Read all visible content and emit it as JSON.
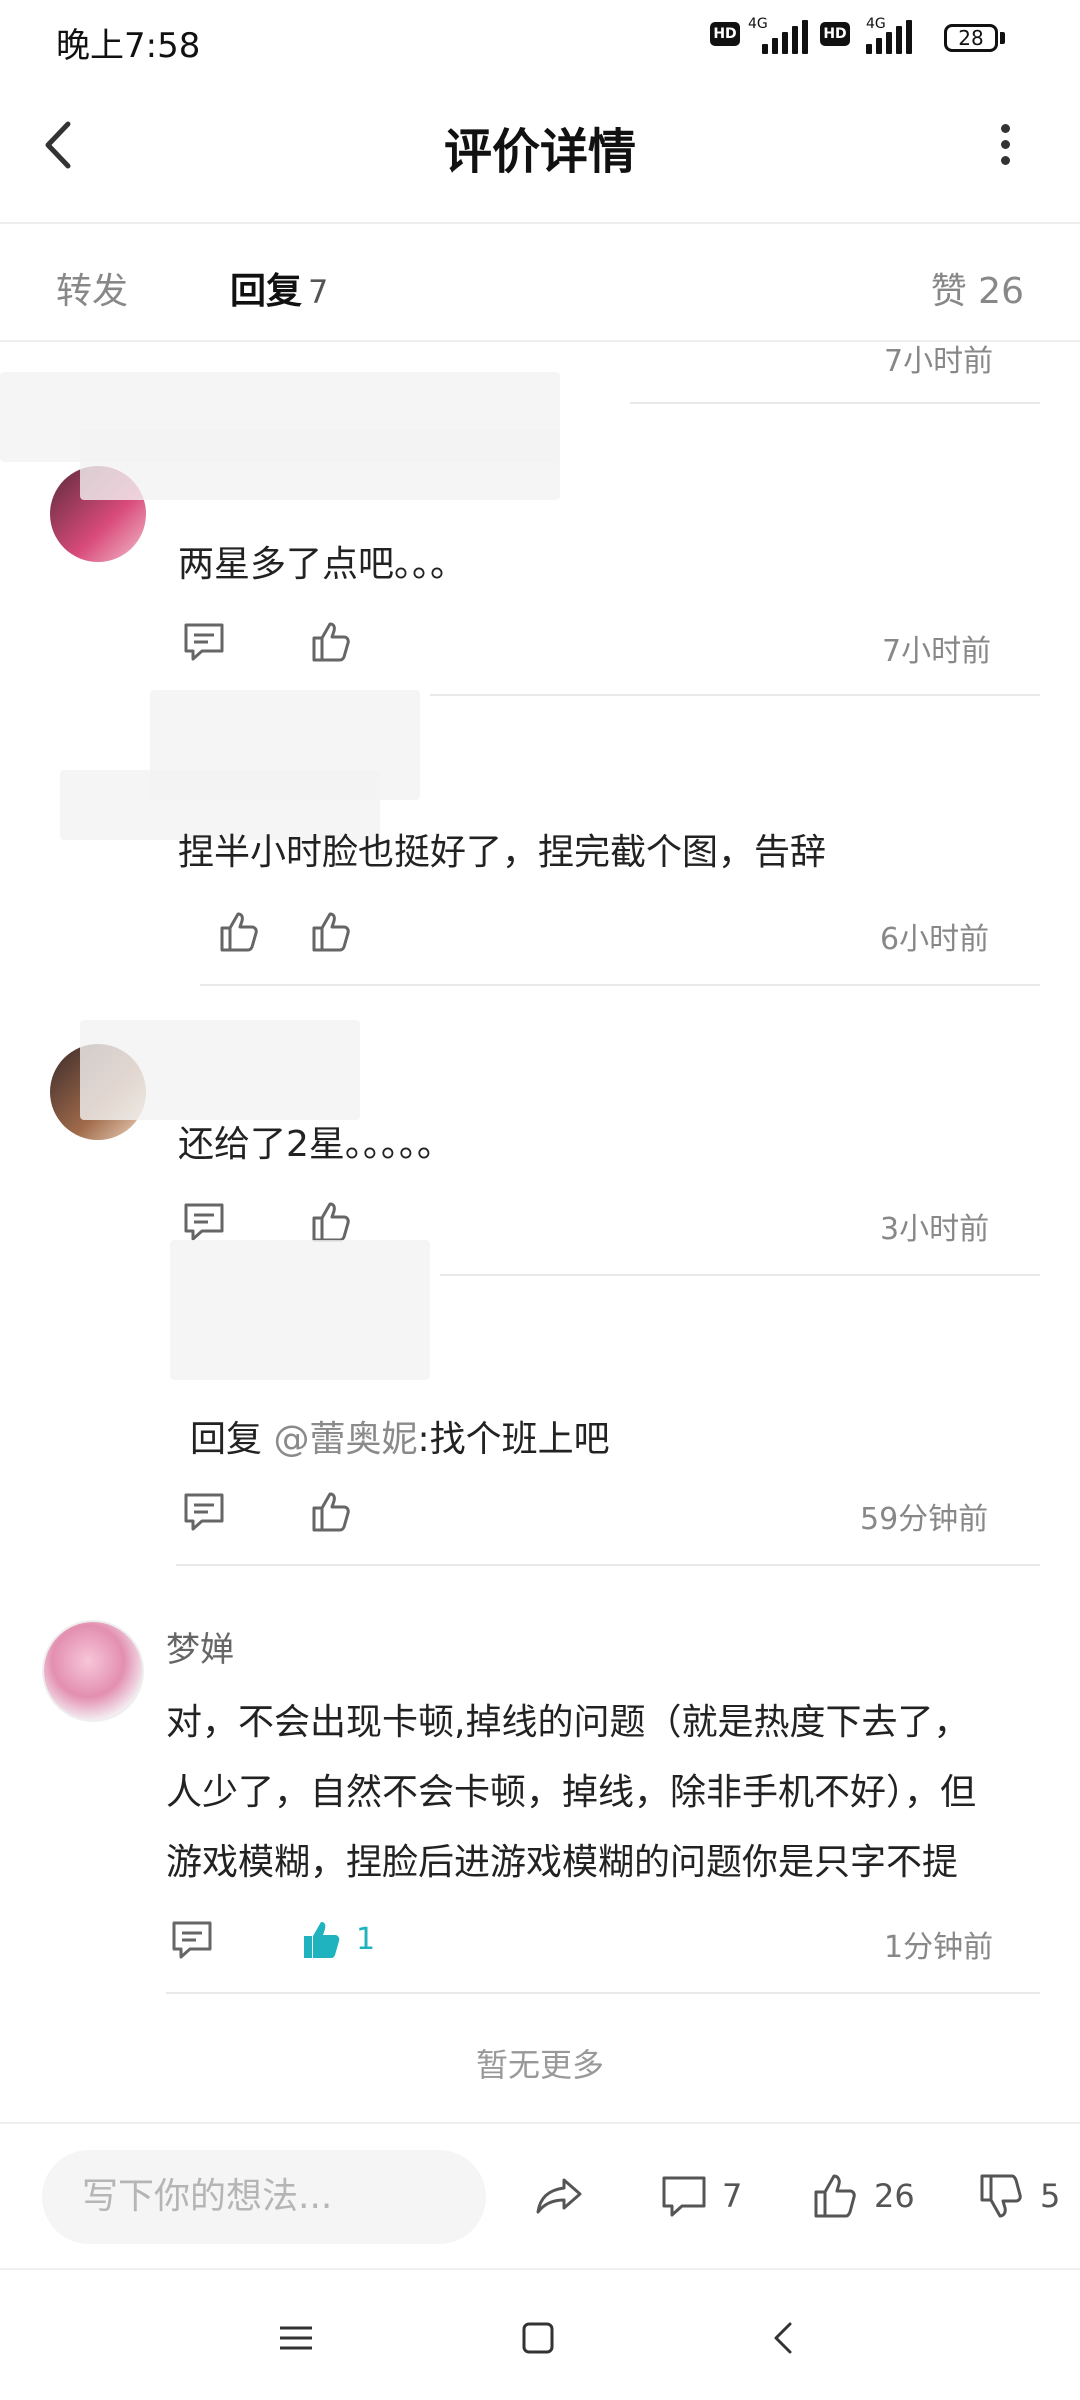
{
  "status_bar": {
    "time": "晚上7:58",
    "hd_label": "HD",
    "network": "4G",
    "battery": "28"
  },
  "header": {
    "title": "评价详情",
    "back_icon": "chevron-left-icon",
    "more_icon": "more-vertical-icon"
  },
  "tabs": {
    "forward": "转发",
    "replies": "回复",
    "replies_count": "7",
    "likes": "赞 26"
  },
  "replies": [
    {
      "time": "7小时前"
    },
    {
      "text": "两星多了点吧。。。",
      "time": "7小时前"
    },
    {
      "text": "捏半小时脸也挺好了，捏完截个图，告辞",
      "time": "6小时前"
    },
    {
      "text": "还给了2星。。。。。",
      "time": "3小时前"
    },
    {
      "reply_prefix": "回复 ",
      "mention": "@蕾奥妮",
      "reply_text": ":找个班上吧",
      "time": "59分钟前"
    }
  ],
  "main_comment": {
    "username": "梦婵",
    "lines": [
      "对，不会出现卡顿,掉线的问题（就是热度下去了，",
      "人少了，自然不会卡顿，掉线，除非手机不好），但",
      "游戏模糊，捏脸后进游戏模糊的问题你是只字不提"
    ],
    "like_count": "1",
    "time": "1分钟前"
  },
  "footer_text": "暂无更多",
  "bottom_bar": {
    "input_placeholder": "写下你的想法...",
    "comment_count": "7",
    "like_count": "26",
    "dislike_count": "5"
  },
  "colors": {
    "accent": "#1fb3bf",
    "text": "#222222",
    "muted": "#888888"
  }
}
